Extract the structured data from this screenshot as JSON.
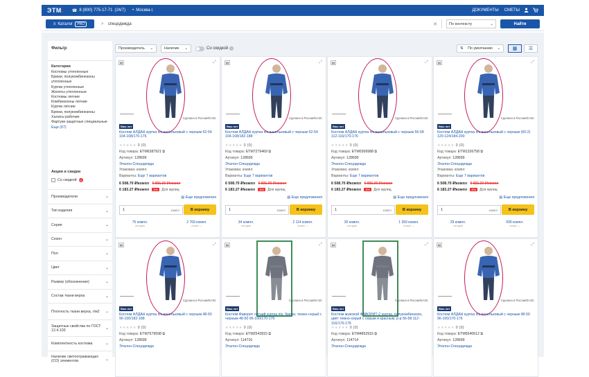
{
  "topbar": {
    "logo": "ЭТМ",
    "phone": "8 (800) 775-17-71",
    "phone_note": "(24/7)",
    "city": "Москва г.",
    "links": [
      "ДОКУМЕНТЫ",
      "СМЕТЫ"
    ],
    "icons": [
      "user-icon",
      "cart-icon"
    ]
  },
  "search": {
    "catalog_label": "Каталог",
    "catalog_pro": "PRO",
    "value": "спецодежда",
    "context_label": "По контексту",
    "find_label": "Найти"
  },
  "sidebar": {
    "filter_title": "Фильтр",
    "categories_title": "Категории",
    "categories": [
      "Костюмы утепленные",
      "Брюки, полукомбинезоны утепленные",
      "Куртки утепленные",
      "Жилеты утепленные",
      "Костюмы летние",
      "Комбинезоны летние",
      "Куртки летние",
      "Брюки, полукомбинезоны",
      "Халаты рабочие",
      "Фартуки защитные специальные"
    ],
    "categories_more": "Еще (67)",
    "promo_title": "Акции и скидки",
    "promo_checkbox": "Со скидкой",
    "facets": [
      "Производители",
      "Тип изделия",
      "Серия",
      "Сезон",
      "Пол",
      "Цвет",
      "Размер (обозначение)",
      "Состав ткани верха",
      "Плотность ткани верха, г/м2",
      "Защитные свойства по ГОСТ 12.4.103",
      "Комплектность костюма",
      "Наличие светоотражающих (СО) элементов"
    ]
  },
  "toolbar": {
    "manufacturer": "Производитель",
    "availability": "Наличие",
    "discount_toggle": "Со скидкой",
    "sort": "По умолчанию"
  },
  "cards": [
    {
      "badge": "Ваш лот",
      "made": "Сделано в России/ЕАЭС",
      "title": "Костюм АЛДАН куртка п/к васильковый с черным 52-54 104-108/170-176",
      "rating": "0 (0)",
      "code": "ETM6387921",
      "article": "128699",
      "brand": "Эталон-Спецодежда",
      "pack": "Упаковка: компл",
      "variants": "Еще 7 вариантов",
      "price": "6 508.70 ₽/компл",
      "price_old": "6 831.33 ₽/компл",
      "price_legal": "6 183.27 ₽/компл",
      "pct": "-5%",
      "legal": "Для юрлиц",
      "offers": "Еще предложения",
      "qty": "1",
      "unit": "компл",
      "cart": "В корзину",
      "stock_left": "75 компл.",
      "stock_left_sub": "сегодня",
      "stock_right": "2 769 компл.",
      "stock_right_sub": "позже →"
    },
    {
      "badge": "Ваш лот",
      "made": "Сделано в России/ЕАЭС",
      "title": "Костюм АЛДАН куртка п/к васильковый с черным 52-54 104-108/182-188",
      "rating": "0 (0)",
      "code": "ETM7279469",
      "article": "128699",
      "brand": "Эталон-Спецодежда",
      "pack": "Упаковка: компл",
      "variants": "Еще 7 вариантов",
      "price": "6 508.70 ₽/компл",
      "price_old": "6 831.33 ₽/компл",
      "price_legal": "6 183.27 ₽/компл",
      "pct": "-5%",
      "legal": "Для юрлиц",
      "offers": "Еще предложения",
      "qty": "1",
      "unit": "компл",
      "cart": "В корзину",
      "stock_left": "34 компл.",
      "stock_left_sub": "сегодня",
      "stock_right": "2 114 компл.",
      "stock_right_sub": "позже →"
    },
    {
      "badge": "Ваш лот",
      "made": "Сделано в России/ЕАЭС",
      "title": "Костюм АЛДАН куртка п/к васильковый с черным 56-58 112-116/170-176",
      "rating": "0 (0)",
      "code": "ETM0369988",
      "article": "128699",
      "brand": "Эталон-Спецодежда",
      "pack": "Упаковка: компл",
      "variants": "Еще 7 вариантов",
      "price": "6 508.70 ₽/компл",
      "price_old": "6 831.33 ₽/компл",
      "price_legal": "6 183.27 ₽/компл",
      "pct": "-5%",
      "legal": "Для юрлиц",
      "offers": "Еще предложения",
      "qty": "1",
      "unit": "компл",
      "cart": "В корзину",
      "stock_left": "30 компл.",
      "stock_left_sub": "сегодня",
      "stock_right": "1 369 компл.",
      "stock_right_sub": "позже →"
    },
    {
      "badge": "Ваш лот",
      "made": "Сделано в России/ЕАЭС",
      "title": "Костюм АЛДАН куртка п/к васильковый с черным (60-2) 120-124/184-200",
      "rating": "0 (0)",
      "code": "ETM1326758",
      "article": "128699",
      "brand": "Эталон-Спецодежда",
      "pack": "Упаковка: компл",
      "variants": "Еще 7 вариантов",
      "price": "6 508.70 ₽/компл",
      "price_old": "6 831.33 ₽/компл",
      "price_legal": "6 183.27 ₽/компл",
      "pct": "-5%",
      "legal": "Для юрлиц",
      "offers": "Еще предложения",
      "qty": "1",
      "unit": "компл",
      "cart": "В корзину",
      "stock_left": "29 компл.",
      "stock_left_sub": "сегодня",
      "stock_right": "695 компл.",
      "stock_right_sub": "позже →"
    },
    {
      "badge": "Ваш лот",
      "made": "Сделано в России/ЕАЭС",
      "title": "Костюм АЛДАН куртка п/к васильковый с черным 48-50 96-100/182-188",
      "rating": "0 (0)",
      "code": "ETM7579598",
      "article": "128699",
      "brand": "Эталон-Спецодежда"
    },
    {
      "badge": "Ваш лот",
      "made": "Сделано в России/ЕАЭС",
      "title": "Костюм Фаворит летний куртка п/к, брюки, темно-серый с черным 48-50 96-100/170-176",
      "rating": "0 (0)",
      "code": "ETM2542815",
      "article": "114716",
      "brand": "Эталон-Спецодежда"
    },
    {
      "badge": "Ваш лот",
      "made": "Сделано в России/ЕАЭС",
      "title": "Костюм мужской ФАВОРИТ-2 куртка, полукомбинезон, цвет темно-серый с серым и красным, р-р 56-58 112-116/170-176",
      "rating": "0 (0)",
      "code": "ETM4852916",
      "article": "114714",
      "brand": "Эталон-Спецодежда"
    },
    {
      "badge": "Ваш лот",
      "made": "Сделано в России/ЕАЭС",
      "title": "Костюм АЛДАН куртка п/к васильковый с черным 48-50 96-100/170-176",
      "rating": "0 (0)",
      "code": "ETM5540612",
      "article": "128699",
      "brand": "Эталон-Спецодежда"
    }
  ],
  "labels": {
    "code": "Код товара:",
    "article": "Артикул:",
    "variants_prefix": "Варианты:"
  },
  "colors": {
    "brand_blue": "#1a56a8",
    "cart_yellow": "#f4c21a",
    "highlight_magenta": "#c2185b",
    "highlight_green": "#3d8b57"
  }
}
